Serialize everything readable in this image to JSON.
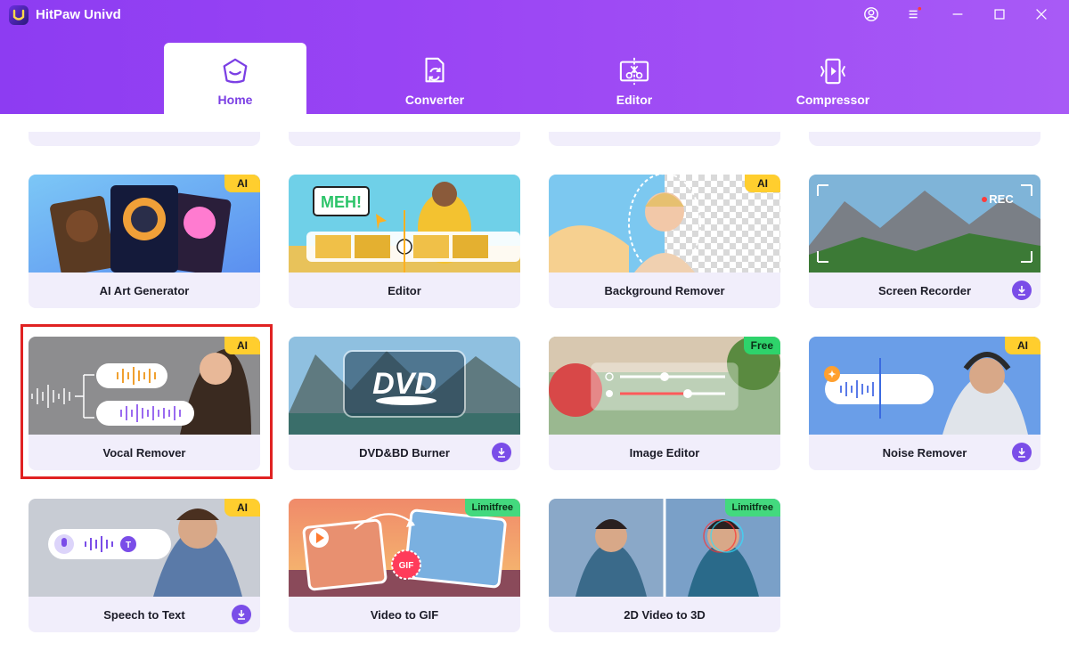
{
  "app": {
    "title": "HitPaw Univd"
  },
  "tabs": [
    {
      "label": "Home",
      "icon": "home-icon",
      "active": true
    },
    {
      "label": "Converter",
      "icon": "converter-icon",
      "active": false
    },
    {
      "label": "Editor",
      "icon": "editor-icon",
      "active": false
    },
    {
      "label": "Compressor",
      "icon": "compressor-icon",
      "active": false
    }
  ],
  "colors": {
    "header": "#9b46f4",
    "accent": "#7b3fe4",
    "card_bg": "#f1eefb",
    "badge_ai": "#ffce2e",
    "badge_free": "#2ed36b",
    "selection": "#e02222"
  },
  "cards": [
    {
      "label": "AI Art Generator",
      "badge": "AI",
      "download": false
    },
    {
      "label": "Editor",
      "badge": "",
      "download": false
    },
    {
      "label": "Background Remover",
      "badge": "AI",
      "download": false
    },
    {
      "label": "Screen Recorder",
      "badge": "",
      "download": true,
      "overlay_text": "REC"
    },
    {
      "label": "Vocal Remover",
      "badge": "AI",
      "download": false,
      "selected": true
    },
    {
      "label": "DVD&BD Burner",
      "badge": "",
      "download": true,
      "overlay_text": "DVD"
    },
    {
      "label": "Image Editor",
      "badge": "Free",
      "download": false
    },
    {
      "label": "Noise Remover",
      "badge": "AI",
      "download": true
    },
    {
      "label": "Speech to Text",
      "badge": "AI",
      "download": true
    },
    {
      "label": "Video to GIF",
      "badge": "Limitfree",
      "download": false,
      "overlay_text": "GIF"
    },
    {
      "label": "2D Video to 3D",
      "badge": "Limitfree",
      "download": false
    }
  ],
  "editor_sticker": "MEH!"
}
